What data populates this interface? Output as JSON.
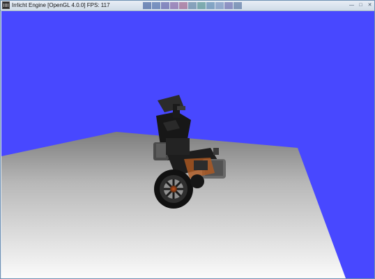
{
  "window": {
    "title": "Irrlicht Engine [OpenGL 4.0.0] FPS: 117",
    "app_icon": "irrlicht-logo-icon",
    "controls": {
      "minimize_icon": "minimize-icon",
      "maximize_icon": "maximize-icon",
      "close_icon": "close-icon"
    }
  },
  "colors": {
    "sky": "#4848ff",
    "floor_light": "#f6f6f6",
    "floor_dark": "#7a7a7a",
    "robot_body": "#151515",
    "accent_orange": "#b5541d",
    "title_swatches": [
      "#1c3f8a",
      "#264c97",
      "#3e3e98",
      "#6a3f94",
      "#8a3f74",
      "#3f6a8f",
      "#2f7a7a",
      "#3a6fa0",
      "#5a7ab0",
      "#4f4f9f",
      "#3b5b8f"
    ]
  },
  "scene": {
    "object": "segway-robot-model",
    "ground": "gray-plane"
  }
}
